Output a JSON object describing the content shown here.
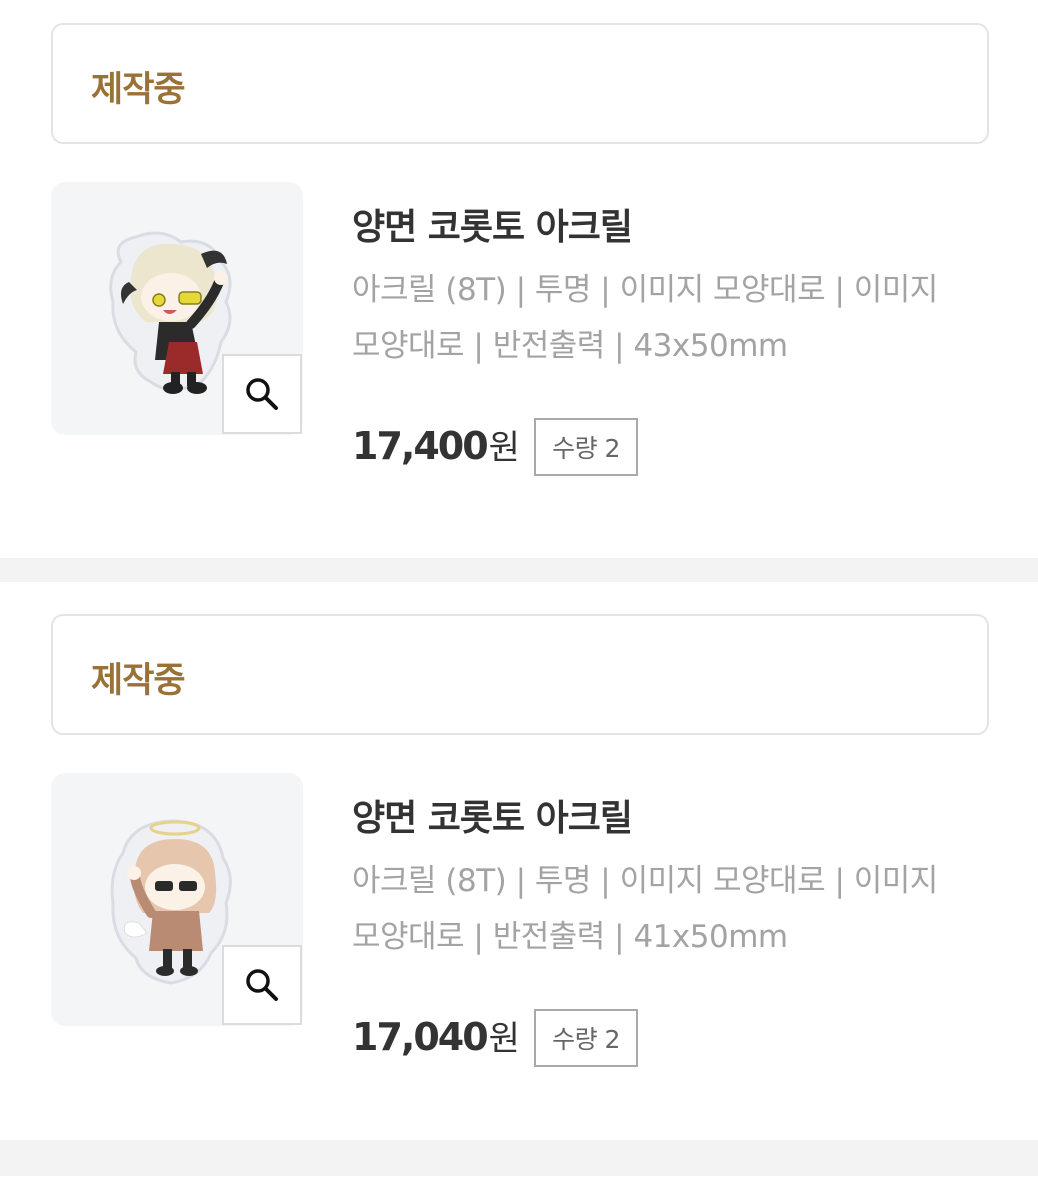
{
  "orders": [
    {
      "status": "제작중",
      "product_name": "양면 코롯토 아크릴",
      "options": "아크릴 (8T) | 투명 | 이미지 모양대로 | 이미지 모양대로 | 반전출력 | 43x50mm",
      "price": "17,400",
      "currency": "원",
      "quantity": "수량 2",
      "thumbnail_icon": "chibi-character-sticker-image",
      "zoom_icon": "magnifier-icon"
    },
    {
      "status": "제작중",
      "product_name": "양면 코롯토 아크릴",
      "options": "아크릴 (8T) | 투명 | 이미지 모양대로 | 이미지 모양대로 | 반전출력 | 41x50mm",
      "price": "17,040",
      "currency": "원",
      "quantity": "수량 2",
      "thumbnail_icon": "chibi-character-sticker-image",
      "zoom_icon": "magnifier-icon"
    }
  ],
  "colors": {
    "status": "#9a7136",
    "title": "#333333",
    "options": "#a3a3a3",
    "divider": "#f3f3f3"
  }
}
